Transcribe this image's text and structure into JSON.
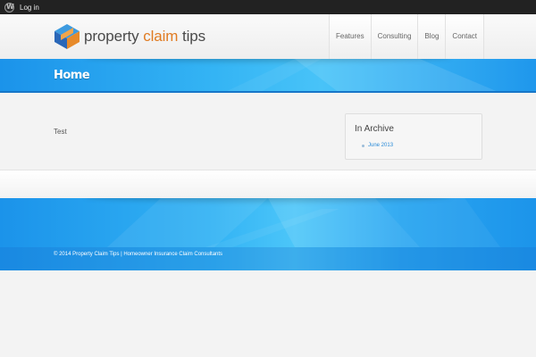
{
  "adminbar": {
    "login_label": "Log in",
    "logo_icon": "wordpress-icon"
  },
  "header": {
    "logo": {
      "word1": "property",
      "word2": "claim",
      "word3": "tips",
      "accent_color": "#e07b22",
      "icon": "cube-logo-icon"
    },
    "nav": [
      {
        "label": "Features"
      },
      {
        "label": "Consulting"
      },
      {
        "label": "Blog"
      },
      {
        "label": "Contact"
      }
    ]
  },
  "title_band": {
    "title": "Home",
    "color": "#1b93ea"
  },
  "main": {
    "post_text": "Test"
  },
  "sidebar": {
    "widget_title": "In Archive",
    "links": [
      {
        "label": "June 2013"
      }
    ]
  },
  "footer": {
    "copyright": "© 2014 Property Claim Tips | Homeowner Insurance Claim Consultants"
  }
}
